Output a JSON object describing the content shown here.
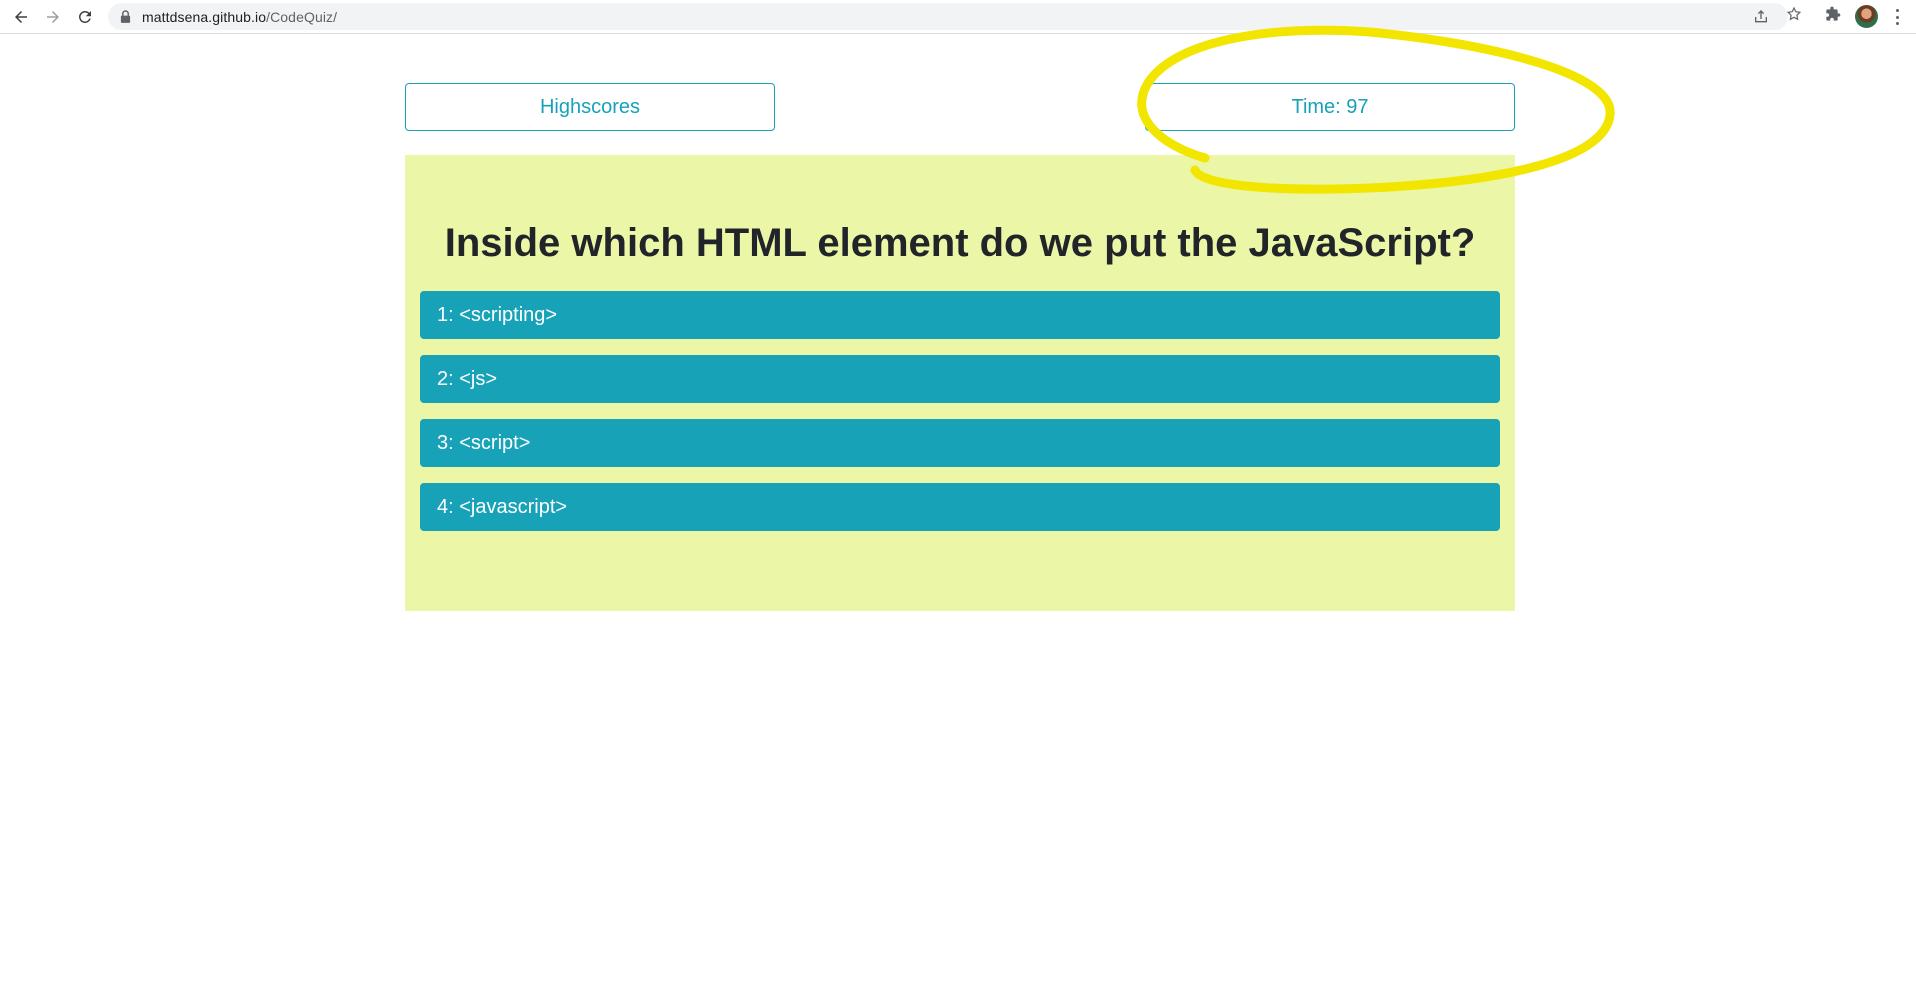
{
  "browser": {
    "url_host": "mattdsena.github.io",
    "url_path": "/CodeQuiz/"
  },
  "header": {
    "highscores_label": "Highscores",
    "timer_label": "Time: 97"
  },
  "quiz": {
    "question": "Inside which HTML element do we put the JavaScript?",
    "answers": [
      {
        "label": "1: <scripting>"
      },
      {
        "label": "2: <js>"
      },
      {
        "label": "3: <script>"
      },
      {
        "label": "4: <javascript>"
      }
    ]
  },
  "colors": {
    "accent": "#17a2b8",
    "card_background": "#ebf7a7",
    "highlight_annotation": "#f2e600"
  }
}
